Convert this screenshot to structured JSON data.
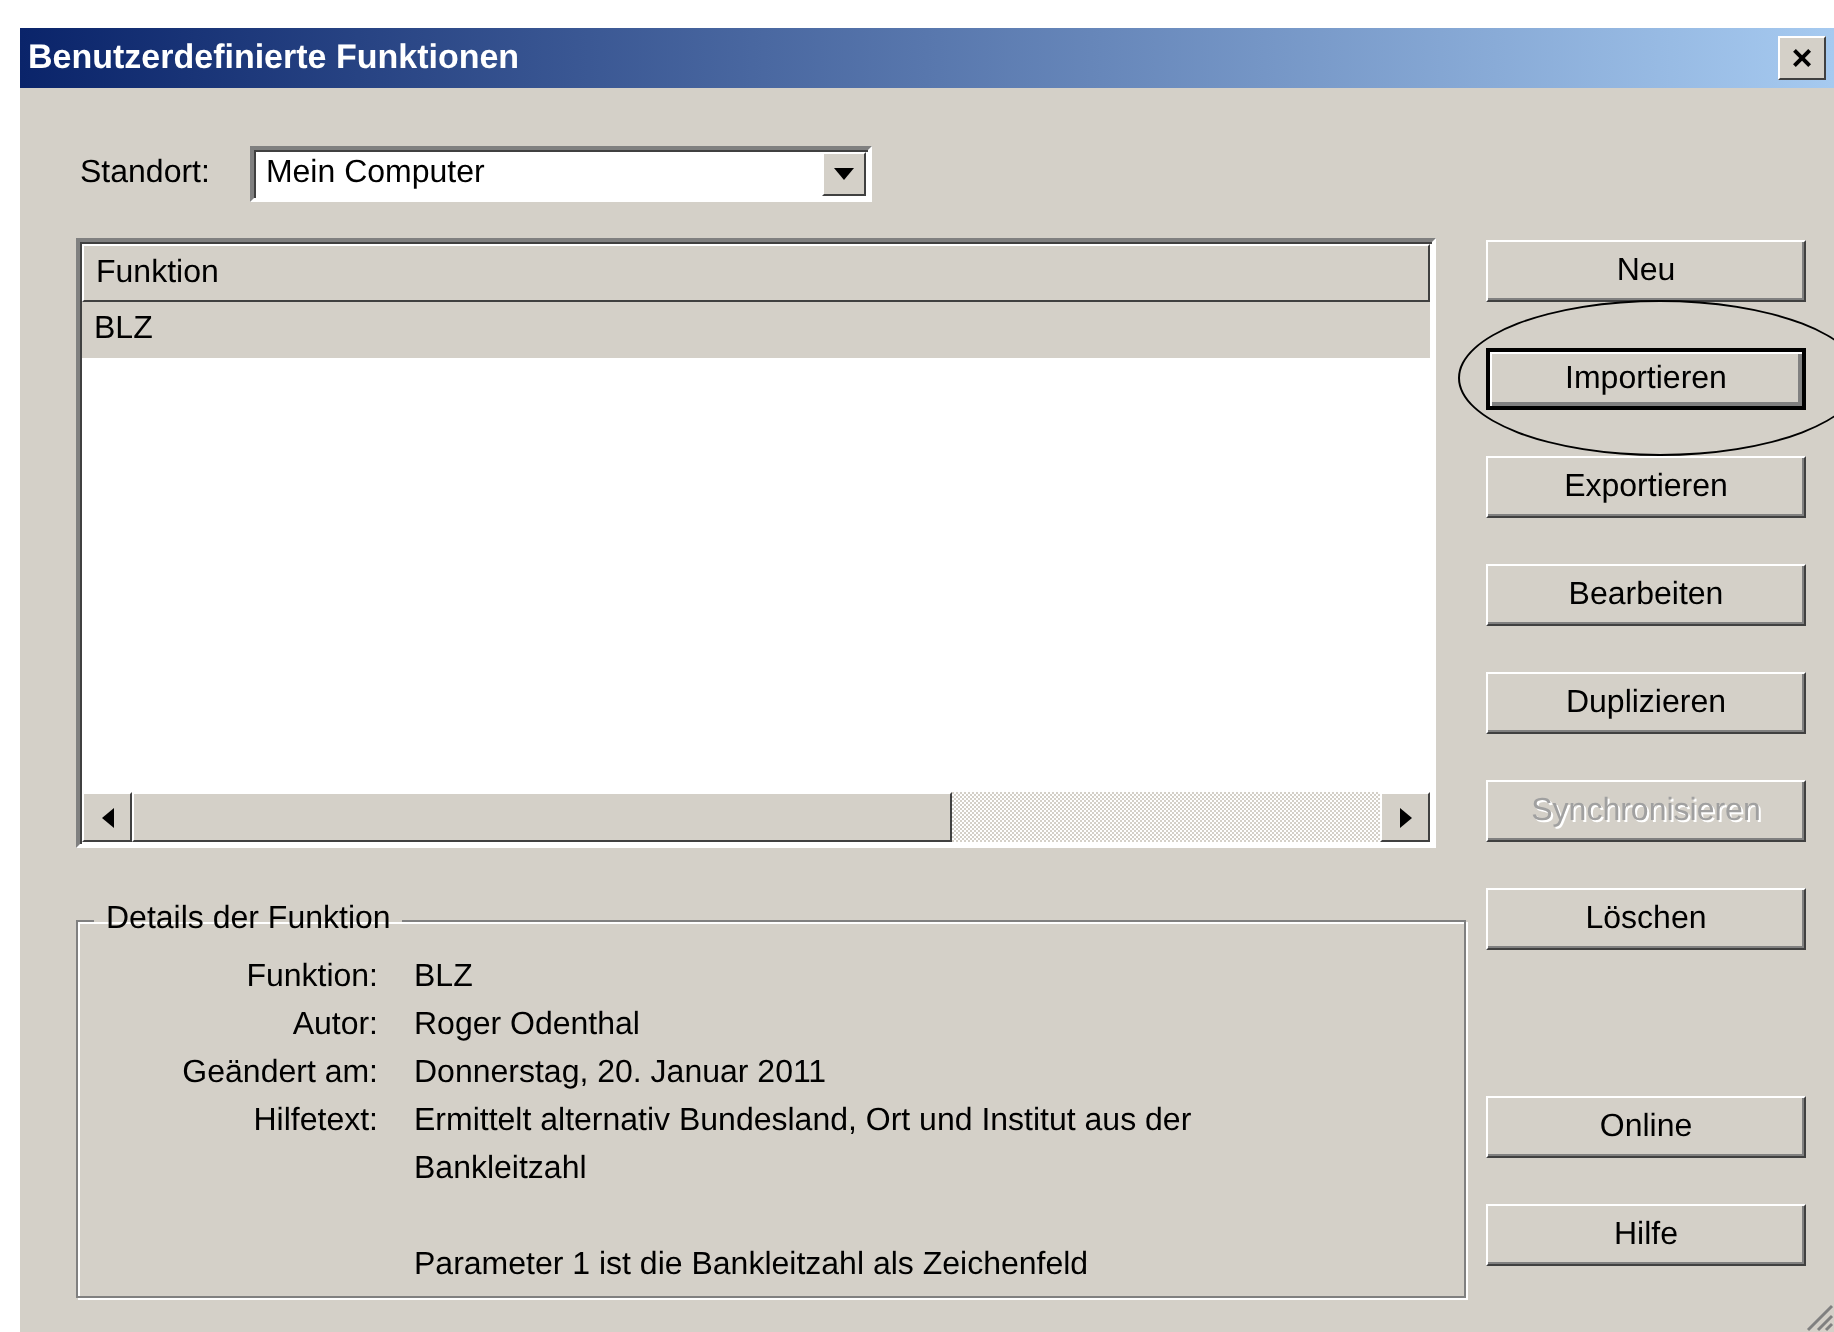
{
  "window": {
    "title": "Benutzerdefinierte Funktionen",
    "close": "×"
  },
  "location": {
    "label": "Standort:",
    "value": "Mein Computer"
  },
  "list": {
    "columns": [
      "Funktion"
    ],
    "rows": [
      {
        "name": "BLZ",
        "selected": true
      }
    ]
  },
  "buttons": [
    {
      "label": "Neu",
      "disabled": false,
      "focused": false,
      "circled": false
    },
    {
      "label": "Importieren",
      "disabled": false,
      "focused": true,
      "circled": true
    },
    {
      "label": "Exportieren",
      "disabled": false,
      "focused": false,
      "circled": false
    },
    {
      "label": "Bearbeiten",
      "disabled": false,
      "focused": false,
      "circled": false
    },
    {
      "label": "Duplizieren",
      "disabled": false,
      "focused": false,
      "circled": false
    },
    {
      "label": "Synchronisieren",
      "disabled": true,
      "focused": false,
      "circled": false
    },
    {
      "label": "Löschen",
      "disabled": false,
      "focused": false,
      "circled": false
    }
  ],
  "help_buttons": [
    {
      "label": "Online",
      "disabled": false,
      "focused": false,
      "circled": false
    },
    {
      "label": "Hilfe",
      "disabled": false,
      "focused": false,
      "circled": false
    }
  ],
  "details": {
    "title": "Details der Funktion",
    "fields": [
      {
        "label": "Funktion:",
        "value": [
          "BLZ"
        ]
      },
      {
        "label": "Autor:",
        "value": [
          "Roger Odenthal"
        ]
      },
      {
        "label": "Geändert am:",
        "value": [
          "Donnerstag, 20. Januar 2011"
        ]
      },
      {
        "label": "Hilfetext:",
        "value": [
          "Ermittelt alternativ Bundesland, Ort und Institut aus der Bankleitzahl",
          "Parameter 1 ist die Bankleitzahl als Zeichenfeld"
        ]
      }
    ]
  }
}
